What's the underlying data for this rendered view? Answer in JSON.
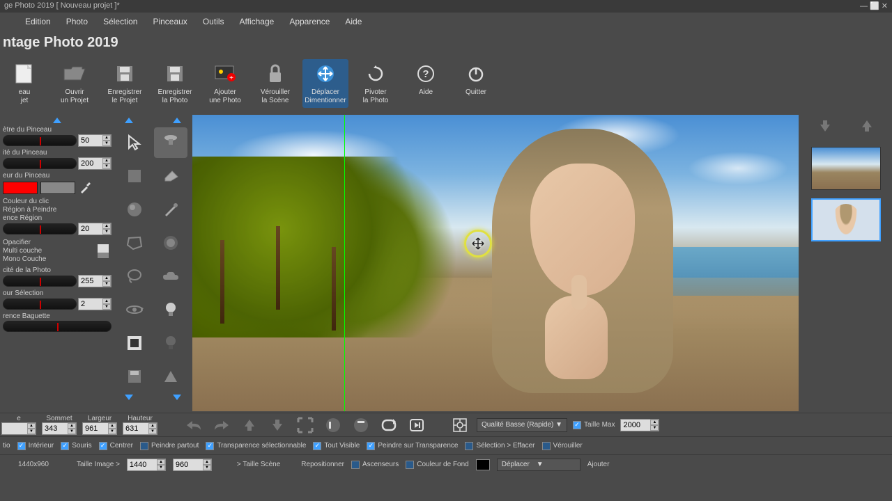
{
  "title": "ge Photo 2019 [ Nouveau projet ]*",
  "menu": [
    "",
    "Edition",
    "Photo",
    "Sélection",
    "Pinceaux",
    "Outils",
    "Affichage",
    "Apparence",
    "Aide"
  ],
  "appname": "ntage Photo 2019",
  "toolbar": [
    {
      "id": "new-project",
      "l1": "eau",
      "l2": "jet"
    },
    {
      "id": "open-project",
      "l1": "Ouvrir",
      "l2": "un Projet"
    },
    {
      "id": "save-project",
      "l1": "Enregistrer",
      "l2": "le Projet"
    },
    {
      "id": "save-photo",
      "l1": "Enregistrer",
      "l2": "la Photo"
    },
    {
      "id": "add-photo",
      "l1": "Ajouter",
      "l2": "une Photo"
    },
    {
      "id": "lock-scene",
      "l1": "Vérouiller",
      "l2": "la Scène"
    },
    {
      "id": "move-resize",
      "l1": "Déplacer",
      "l2": "Dimentionner",
      "active": true
    },
    {
      "id": "rotate-photo",
      "l1": "Pivoter",
      "l2": "la Photo"
    },
    {
      "id": "help",
      "l1": "Aide",
      "l2": ""
    },
    {
      "id": "quit",
      "l1": "Quitter",
      "l2": ""
    }
  ],
  "brush": {
    "diam_label": "ètre du Pinceau",
    "diam": "50",
    "opac_label": "ité du Pinceau",
    "opac": "200",
    "color_label": "eur du Pinceau",
    "click_color": "Couleur du clic",
    "region_paint": "Région à Peindre",
    "region_tol_label": "ence Région",
    "region_tol": "20",
    "opacifier": "Opacifier",
    "multi_layer": "Multi couche",
    "mono_layer": "Mono Couche",
    "photo_opac_label": "cité de la Photo",
    "photo_opac": "255",
    "contour_label": "our Sélection",
    "contour": "2",
    "wand_label": "rence Baguette"
  },
  "coords": {
    "left_lbl": "e",
    "top_lbl": "Sommet",
    "top": "343",
    "width_lbl": "Largeur",
    "width": "961",
    "height_lbl": "Hauteur",
    "height": "631"
  },
  "quality": {
    "label": "Qualité Basse (Rapide)",
    "max_label": "Taille Max",
    "max": "2000"
  },
  "opts": {
    "ratio": "tio",
    "interior": "Intérieur",
    "mouse": "Souris",
    "center": "Centrer",
    "paint_all": "Peindre partout",
    "trans_sel": "Transparence sélectionnable",
    "all_visible": "Tout Visible",
    "paint_trans": "Peindre sur Transparence",
    "sel_erase": "Sélection > Effacer",
    "lock": "Vérouiller"
  },
  "size": {
    "dims": "1440x960",
    "img_label": "Taille Image >",
    "w": "1440",
    "h": "960",
    "scene_label": "> Taille Scène",
    "repos": "Repositionner",
    "elev": "Ascenseurs",
    "bgcolor": "Couleur de Fond",
    "move": "Déplacer",
    "add": "Ajouter"
  }
}
